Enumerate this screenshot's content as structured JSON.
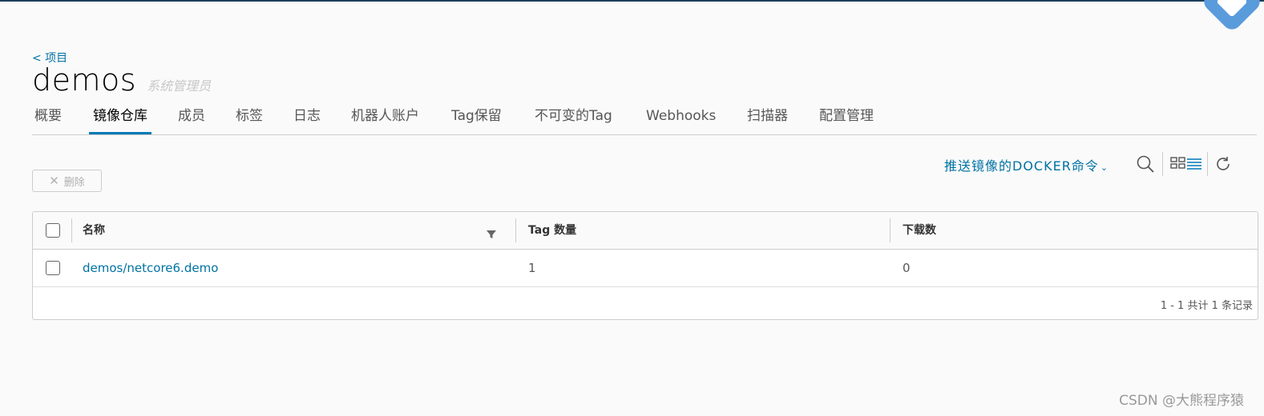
{
  "breadcrumb": "< 项目",
  "project": {
    "name": "demos",
    "role": "系统管理员"
  },
  "tabs": [
    "概要",
    "镜像仓库",
    "成员",
    "标签",
    "日志",
    "机器人账户",
    "Tag保留",
    "不可变的Tag",
    "Webhooks",
    "扫描器",
    "配置管理"
  ],
  "active_tab": "镜像仓库",
  "toolbar": {
    "delete_label": "删除",
    "docker_cmd_label": "推送镜像的DOCKER命令",
    "icons": [
      "search-icon",
      "card-view-icon",
      "list-view-icon",
      "refresh-icon"
    ]
  },
  "table": {
    "columns": [
      "名称",
      "Tag 数量",
      "下载数"
    ],
    "rows": [
      {
        "name": "demos/netcore6.demo",
        "tags": "1",
        "pulls": "0"
      }
    ],
    "footer": "1 - 1 共计 1 条记录"
  },
  "watermark": "CSDN @大熊程序猿",
  "colors": {
    "accent": "#0072a3",
    "tab_underline": "#0079b8",
    "top_bar": "#1d3f5c"
  }
}
